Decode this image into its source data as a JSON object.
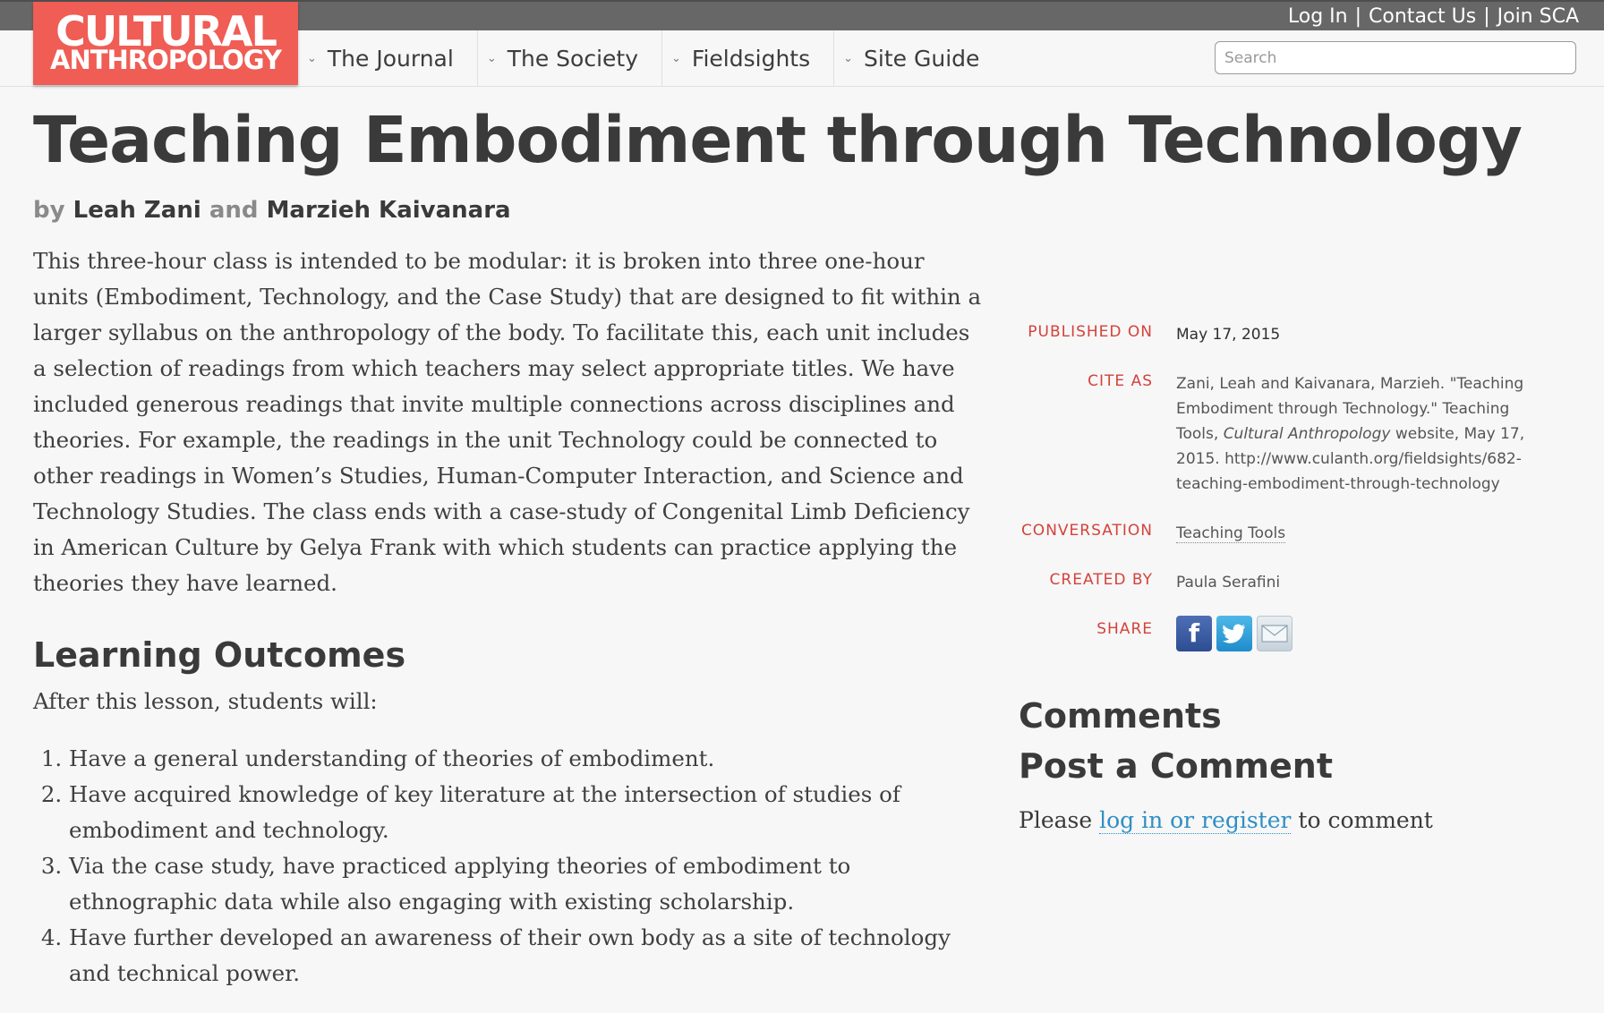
{
  "top_links": [
    "Log In",
    "Contact Us",
    "Join SCA"
  ],
  "logo": {
    "line1": "CULTURAL",
    "line2": "ANTHROPOLOGY"
  },
  "nav": [
    {
      "label": "The Journal"
    },
    {
      "label": "The Society"
    },
    {
      "label": "Fieldsights"
    },
    {
      "label": "Site Guide"
    }
  ],
  "search": {
    "placeholder": "Search",
    "value": ""
  },
  "article": {
    "title": "Teaching Embodiment through Technology",
    "by": "by",
    "author1": "Leah Zani",
    "and": "and",
    "author2": "Marzieh Kaivanara",
    "intro": "This three-hour class is intended to be modular: it is broken into three one-hour units (Embodiment, Technology, and the Case Study) that are designed to fit within a larger syllabus on the anthropology of the body. To facilitate this, each unit includes a selection of readings from which teachers may select appropriate titles. We have included generous readings that invite multiple connections across disciplines and theories. For example, the readings in the unit Technology could be connected to other readings in Women’s Studies, Human-Computer Interaction, and Science and Technology Studies. The class ends with a case-study of Congenital Limb Deficiency in American Culture by Gelya Frank with which students can practice applying the theories they have learned.",
    "outcomes_heading": "Learning Outcomes",
    "outcomes_intro": "After this lesson, students will:",
    "outcomes": [
      "Have a general understanding of theories of embodiment.",
      "Have acquired knowledge of key literature at the intersection of studies of embodiment and technology.",
      "Via the case study, have practiced applying theories of embodiment to ethnographic data while also engaging with existing scholarship.",
      "Have further developed an awareness of their own body as a site of technology and technical power."
    ]
  },
  "meta": {
    "published_label": "PUBLISHED ON",
    "published_value": "May 17, 2015",
    "cite_label": "CITE AS",
    "cite_pre": "Zani, Leah and Kaivanara, Marzieh. \"Teaching Embodiment through Technology.\" Teaching Tools, ",
    "cite_italic": "Cultural Anthropology",
    "cite_post": " website, May 17, 2015. http://www.culanth.org/fieldsights/682-teaching-embodiment-through-technology",
    "conversation_label": "CONVERSATION",
    "conversation_value": "Teaching Tools",
    "created_label": "CREATED BY",
    "created_value": "Paula Serafini",
    "share_label": "SHARE",
    "share_icons": [
      "facebook-icon",
      "twitter-icon",
      "email-icon"
    ]
  },
  "comments": {
    "heading": "Comments",
    "post_heading": "Post a Comment",
    "please": "Please ",
    "link": "log in or register",
    "after": " to comment"
  },
  "colors": {
    "logo_bg": "#ef5d55",
    "meta_label": "#d4423b",
    "link": "#2f8fc4",
    "topbar": "#676767"
  }
}
